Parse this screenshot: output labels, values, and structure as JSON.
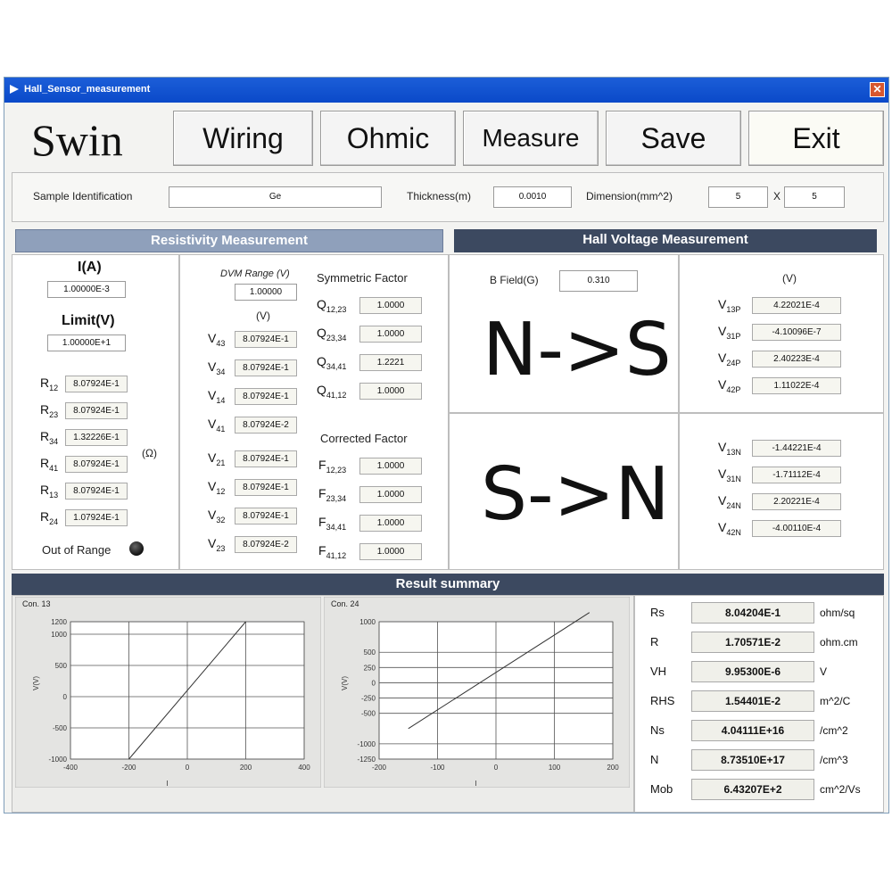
{
  "window": {
    "title": "Hall_Sensor_measurement",
    "close_glyph": "✕"
  },
  "logo": "Swin",
  "toolbar": {
    "wiring": "Wiring",
    "ohmic": "Ohmic",
    "measure": "Measure",
    "save": "Save",
    "exit": "Exit"
  },
  "sample": {
    "id_label": "Sample Identification",
    "id_value": "Ge",
    "thickness_label": "Thickness(m)",
    "thickness_value": "0.0010",
    "dimension_label": "Dimension(mm^2)",
    "dim_a": "5",
    "dim_x": "X",
    "dim_b": "5"
  },
  "resistivity": {
    "title": "Resistivity Measurement",
    "current_label": "I(A)",
    "current_value": "1.00000E-3",
    "limit_label": "Limit(V)",
    "limit_value": "1.00000E+1",
    "r_unit": "(Ω)",
    "resistances": [
      {
        "name": "R",
        "sub": "12",
        "value": "8.07924E-1"
      },
      {
        "name": "R",
        "sub": "23",
        "value": "8.07924E-1"
      },
      {
        "name": "R",
        "sub": "34",
        "value": "1.32226E-1"
      },
      {
        "name": "R",
        "sub": "41",
        "value": "8.07924E-1"
      },
      {
        "name": "R",
        "sub": "13",
        "value": "8.07924E-1"
      },
      {
        "name": "R",
        "sub": "24",
        "value": "1.07924E-1"
      }
    ],
    "out_of_range_label": "Out of Range",
    "dvm_range_label": "DVM Range (V)",
    "dvm_range_value": "1.00000",
    "v_unit": "(V)",
    "voltages_a": [
      {
        "name": "V",
        "sub": "43",
        "value": "8.07924E-1"
      },
      {
        "name": "V",
        "sub": "34",
        "value": "8.07924E-1"
      },
      {
        "name": "V",
        "sub": "14",
        "value": "8.07924E-1"
      },
      {
        "name": "V",
        "sub": "41",
        "value": "8.07924E-2"
      }
    ],
    "voltages_b": [
      {
        "name": "V",
        "sub": "21",
        "value": "8.07924E-1"
      },
      {
        "name": "V",
        "sub": "12",
        "value": "8.07924E-1"
      },
      {
        "name": "V",
        "sub": "32",
        "value": "8.07924E-1"
      },
      {
        "name": "V",
        "sub": "23",
        "value": "8.07924E-2"
      }
    ],
    "symmetry_label": "Symmetric Factor",
    "symmetry": [
      {
        "name": "Q",
        "sub": "12,23",
        "value": "1.0000"
      },
      {
        "name": "Q",
        "sub": "23,34",
        "value": "1.0000"
      },
      {
        "name": "Q",
        "sub": "34,41",
        "value": "1.2221"
      },
      {
        "name": "Q",
        "sub": "41,12",
        "value": "1.0000"
      }
    ],
    "correction_label": "Corrected Factor",
    "correction": [
      {
        "name": "F",
        "sub": "12,23",
        "value": "1.0000"
      },
      {
        "name": "F",
        "sub": "23,34",
        "value": "1.0000"
      },
      {
        "name": "F",
        "sub": "34,41",
        "value": "1.0000"
      },
      {
        "name": "F",
        "sub": "41,12",
        "value": "1.0000"
      }
    ]
  },
  "hall": {
    "title": "Hall Voltage Measurement",
    "bfield_label": "B Field(G)",
    "bfield_value": "0.310",
    "ns_label": "N->S",
    "sn_label": "S->N",
    "v_unit": "(V)",
    "ns_values": [
      {
        "name": "V",
        "sub": "13P",
        "value": "4.22021E-4"
      },
      {
        "name": "V",
        "sub": "31P",
        "value": "-4.10096E-7"
      },
      {
        "name": "V",
        "sub": "24P",
        "value": "2.40223E-4"
      },
      {
        "name": "V",
        "sub": "42P",
        "value": "1.11022E-4"
      }
    ],
    "sn_values": [
      {
        "name": "V",
        "sub": "13N",
        "value": "-1.44221E-4"
      },
      {
        "name": "V",
        "sub": "31N",
        "value": "-1.71112E-4"
      },
      {
        "name": "V",
        "sub": "24N",
        "value": "2.20221E-4"
      },
      {
        "name": "V",
        "sub": "42N",
        "value": "-4.00110E-4"
      }
    ]
  },
  "summary": {
    "title": "Result summary",
    "rows": [
      {
        "label": "Rs",
        "value": "8.04204E-1",
        "unit": "ohm/sq"
      },
      {
        "label": "R",
        "value": "1.70571E-2",
        "unit": "ohm.cm"
      },
      {
        "label": "VH",
        "value": "9.95300E-6",
        "unit": "V"
      },
      {
        "label": "RHS",
        "value": "1.54401E-2",
        "unit": "m^2/C"
      },
      {
        "label": "Ns",
        "value": "4.04111E+16",
        "unit": "/cm^2"
      },
      {
        "label": "N",
        "value": "8.73510E+17",
        "unit": "/cm^3"
      },
      {
        "label": "Mob",
        "value": "6.43207E+2",
        "unit": "cm^2/Vs"
      }
    ]
  },
  "chart_data": [
    {
      "type": "line",
      "title": "Con. 13",
      "xlabel": "I",
      "ylabel": "V(V)",
      "xlim": [
        -400,
        200
      ],
      "x_ticks": [
        "-400",
        "-200",
        "0",
        "200",
        "400"
      ],
      "ylim": [
        -1000,
        1200
      ],
      "y_ticks": [
        "1200",
        "1000",
        "500",
        "0",
        "-500",
        "-1000"
      ],
      "series": [
        {
          "points": [
            [
              -200,
              -1000
            ],
            [
              200,
              1200
            ]
          ]
        }
      ]
    },
    {
      "type": "line",
      "title": "Con. 24",
      "xlabel": "I",
      "ylabel": "V(V)",
      "xlim": [
        -200,
        200
      ],
      "x_ticks": [
        "-200",
        "-100",
        "0",
        "100",
        "200"
      ],
      "ylim": [
        -1250,
        1250
      ],
      "y_ticks": [
        "1000",
        "500",
        "250",
        "0",
        "-250",
        "-500",
        "-1000",
        "-1250"
      ],
      "series": [
        {
          "points": [
            [
              -150,
              -750
            ],
            [
              160,
              1150
            ]
          ]
        }
      ]
    }
  ],
  "colors": {
    "title_bar": "#0a49c9",
    "hdr_light": "#8fa0bb",
    "hdr_dark": "#3c4960",
    "led": "#1c1c1c"
  }
}
